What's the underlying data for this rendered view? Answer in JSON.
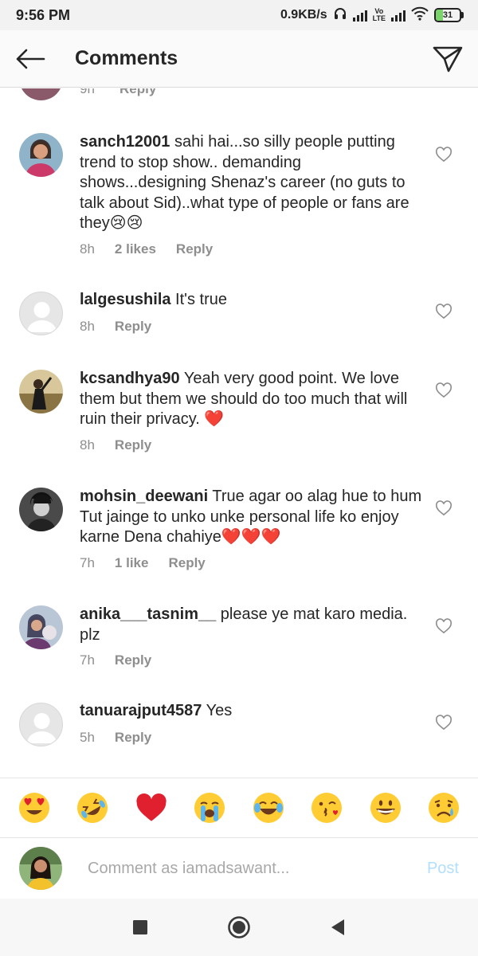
{
  "status_bar": {
    "time": "9:56 PM",
    "speed": "0.9KB/s",
    "volte_top": "Vo",
    "volte_bottom": "LTE",
    "battery": "31"
  },
  "header": {
    "title": "Comments"
  },
  "partial_comment": {
    "time": "9h",
    "reply": "Reply"
  },
  "comments": [
    {
      "username": "sanch12001",
      "text": " sahi hai...so silly people putting trend to stop show.. demanding shows...designing Shenaz's career (no guts to talk about Sid)..what type of people or fans are they😢😢",
      "time": "8h",
      "likes": "2 likes",
      "reply": "Reply"
    },
    {
      "username": "lalgesushila",
      "text": " It's true",
      "time": "8h",
      "likes": "",
      "reply": "Reply"
    },
    {
      "username": "kcsandhya90",
      "text": " Yeah very good point. We love them but them we should do too much that will ruin their privacy. ❤️",
      "time": "8h",
      "likes": "",
      "reply": "Reply"
    },
    {
      "username": "mohsin_deewani",
      "text": " True agar oo alag hue to hum Tut jainge to unko unke personal life ko enjoy karne Dena chahiye❤️❤️❤️",
      "time": "7h",
      "likes": "1 like",
      "reply": "Reply"
    },
    {
      "username": "anika___tasnim__",
      "text": " please ye mat karo media. plz",
      "time": "7h",
      "likes": "",
      "reply": "Reply"
    },
    {
      "username": "tanuarajput4587",
      "text": " Yes",
      "time": "5h",
      "likes": "",
      "reply": "Reply"
    }
  ],
  "emoji_bar": [
    "heart-eyes",
    "rolling-laughing",
    "red-heart",
    "loudly-crying",
    "tears-of-joy",
    "face-blowing-kiss",
    "grinning-face",
    "crying-face"
  ],
  "composer": {
    "placeholder": "Comment as iamadsawant...",
    "post_label": "Post"
  },
  "colors": {
    "meta_grey": "#8e8e8e",
    "post_blue": "#b2dffc",
    "heart_red": "#e0202e",
    "emoji_yellow": "#ffcc33"
  }
}
